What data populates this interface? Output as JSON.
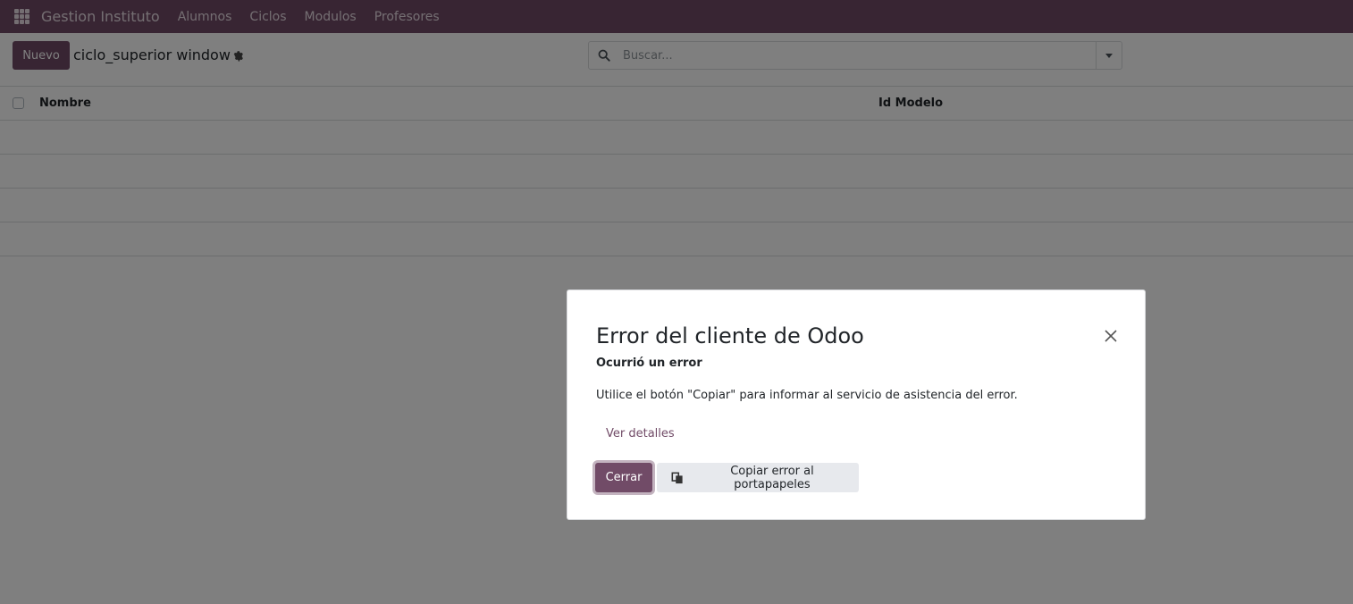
{
  "navbar": {
    "app_name": "Gestion Instituto",
    "items": [
      {
        "label": "Alumnos"
      },
      {
        "label": "Ciclos"
      },
      {
        "label": "Modulos"
      },
      {
        "label": "Profesores"
      }
    ],
    "color": "#714b67"
  },
  "control_panel": {
    "new_button": "Nuevo",
    "title": "ciclo_superior window",
    "search_placeholder": "Buscar..."
  },
  "list": {
    "columns": [
      {
        "label": "Nombre"
      },
      {
        "label": "Id Modelo"
      }
    ]
  },
  "dialog": {
    "title": "Error del cliente de Odoo",
    "subtitle": "Ocurrió un error",
    "message": "Utilice el botón \"Copiar\" para informar al servicio de asistencia del error.",
    "details_link": "Ver detalles",
    "close_button": "Cerrar",
    "copy_button": "Copiar error al portapapeles"
  },
  "icons": {
    "apps": "apps-grid-icon",
    "gear": "gear-icon",
    "search": "search-icon",
    "caret": "caret-down-icon",
    "close": "close-icon",
    "copy": "clipboard-copy-icon"
  }
}
